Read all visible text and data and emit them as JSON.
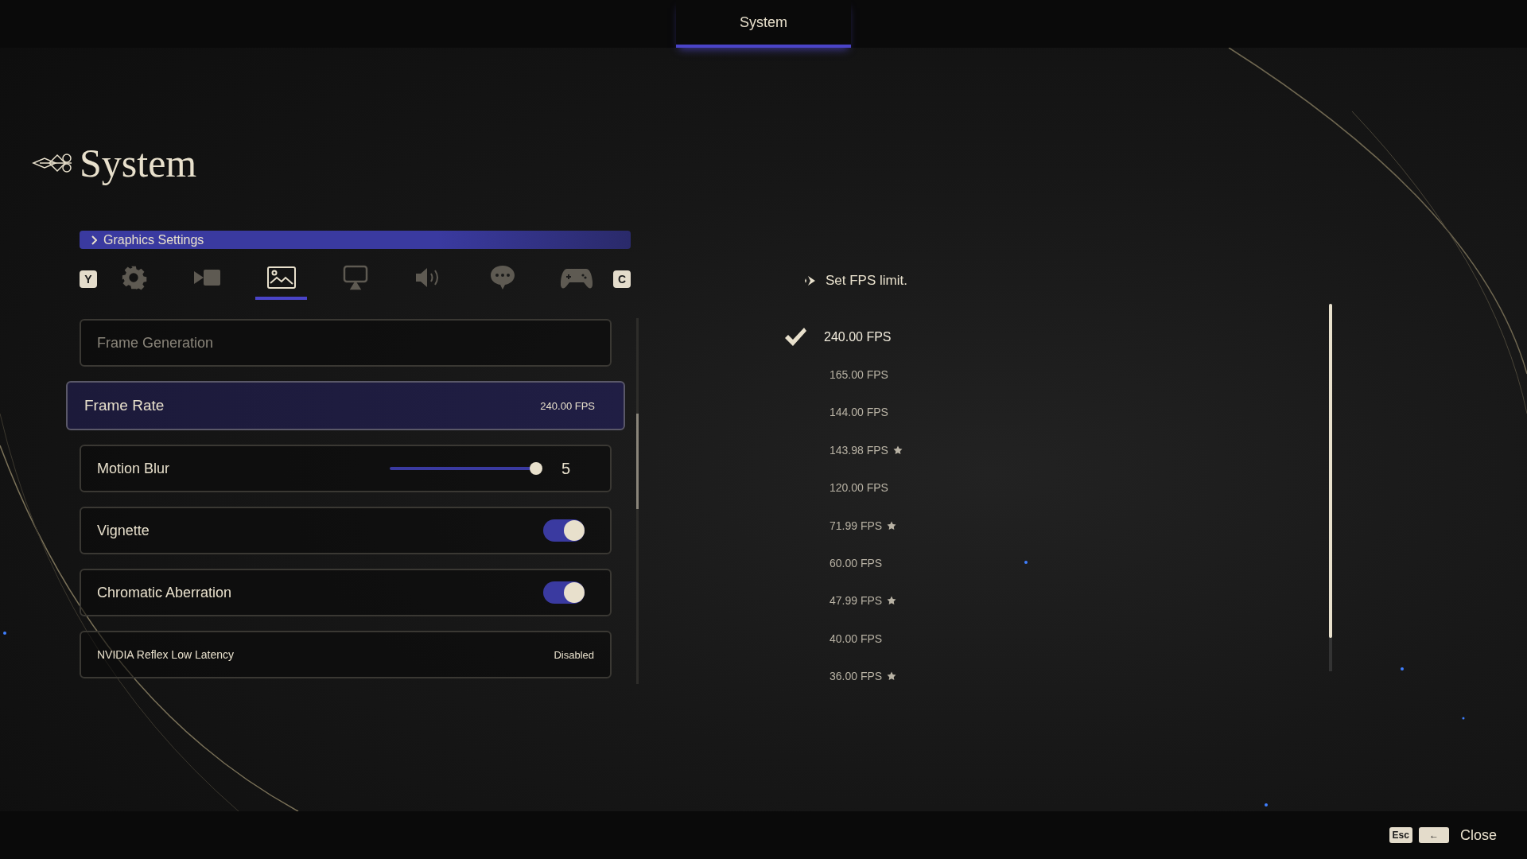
{
  "top_bar": {
    "tabs": [
      {
        "label": "System",
        "selected": true
      }
    ]
  },
  "title": "System",
  "section": {
    "label": "Graphics Settings"
  },
  "category_tabs": {
    "prev_key": "Y",
    "next_key": "C",
    "tabs": [
      {
        "selected": false
      },
      {
        "selected": false
      },
      {
        "selected": true
      },
      {
        "selected": false
      },
      {
        "selected": false
      },
      {
        "selected": false
      },
      {
        "selected": false
      }
    ]
  },
  "settings": [
    {
      "kind": "value",
      "label": "Frame Generation",
      "disabled": true,
      "selected": false
    },
    {
      "kind": "value",
      "label": "Frame Rate",
      "value": "240.00 FPS",
      "disabled": false,
      "selected": true
    },
    {
      "kind": "slider",
      "label": "Motion Blur",
      "level": 0.96,
      "reading": "5",
      "disabled": false,
      "selected": false
    },
    {
      "kind": "toggle",
      "label": "Vignette",
      "on": true,
      "disabled": false,
      "selected": false
    },
    {
      "kind": "toggle",
      "label": "Chromatic Aberration",
      "on": true,
      "disabled": false,
      "selected": false
    },
    {
      "kind": "compact",
      "label": "NVIDIA Reflex Low Latency",
      "value": "Disabled",
      "disabled": false,
      "selected": false
    }
  ],
  "options_panel": {
    "hint": "Set FPS limit.",
    "options": [
      {
        "label": "240.00 FPS",
        "selected": true,
        "starred": false
      },
      {
        "label": "165.00 FPS",
        "selected": false,
        "starred": false
      },
      {
        "label": "144.00 FPS",
        "selected": false,
        "starred": false
      },
      {
        "label": "143.98 FPS",
        "selected": false,
        "starred": true
      },
      {
        "label": "120.00 FPS",
        "selected": false,
        "starred": false
      },
      {
        "label": "71.99 FPS",
        "selected": false,
        "starred": true
      },
      {
        "label": "60.00 FPS",
        "selected": false,
        "starred": false
      },
      {
        "label": "47.99 FPS",
        "selected": false,
        "starred": true
      },
      {
        "label": "40.00 FPS",
        "selected": false,
        "starred": false
      },
      {
        "label": "36.00 FPS",
        "selected": false,
        "starred": true
      }
    ]
  },
  "footer": {
    "keys": [
      "Esc",
      "←"
    ],
    "action": "Close"
  }
}
